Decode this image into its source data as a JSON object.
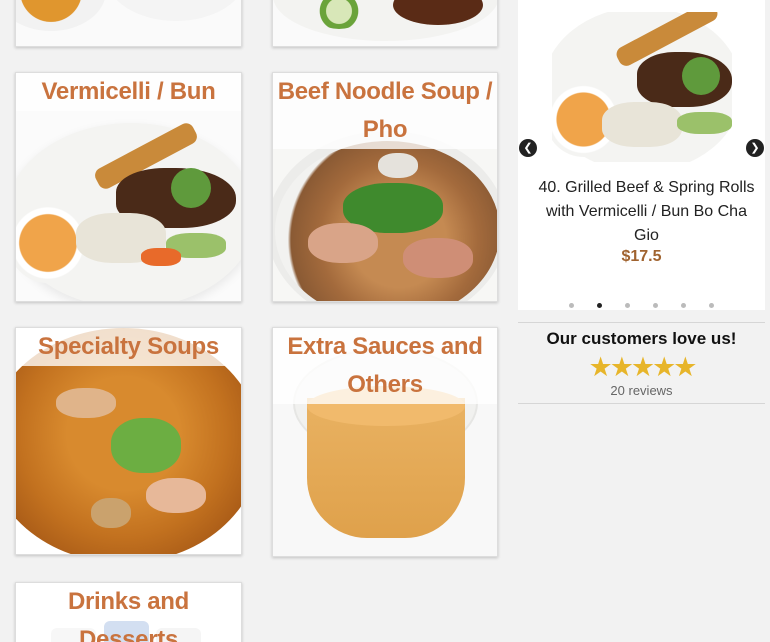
{
  "categories": [
    {
      "title": "Vermicelli / Bun"
    },
    {
      "title": "Beef Noodle Soup / Pho"
    },
    {
      "title": "Specialty Soups"
    },
    {
      "title": "Extra Sauces and Others"
    },
    {
      "title": "Drinks and Desserts"
    }
  ],
  "carousel": {
    "prev_icon": "chevron-left-icon",
    "next_icon": "chevron-right-icon",
    "prev_glyph": "❮",
    "next_glyph": "❯",
    "caption": "40. Grilled Beef & Spring Rolls with Vermicelli / Bun Bo Cha Gio",
    "price": "$17.5",
    "dots_total": 6,
    "active_dot": 1
  },
  "reviews": {
    "title": "Our customers love us!",
    "stars": "★★★★★",
    "rating": 5,
    "count": "20 reviews"
  },
  "colors": {
    "title_accent": "#c9733e",
    "price": "#a0632f",
    "star": "#e7b52a"
  }
}
